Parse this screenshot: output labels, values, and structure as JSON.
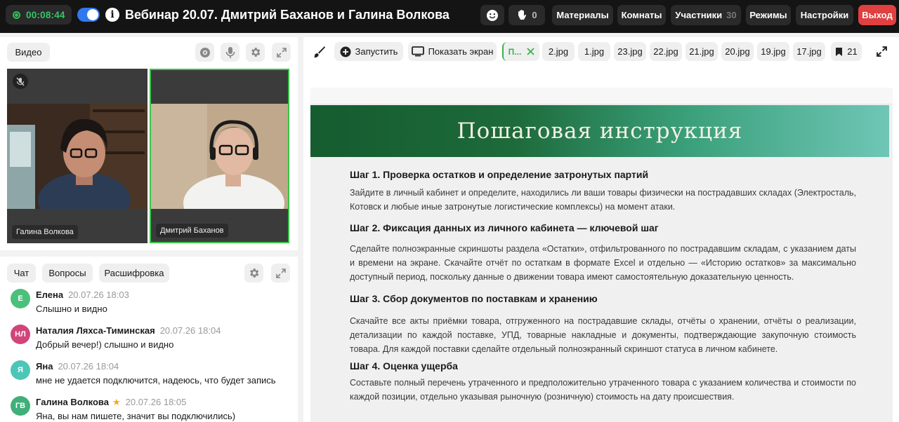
{
  "header": {
    "timer": "00:08:44",
    "title": "Вебинар 20.07. Дмитрий Баханов и Галина Волкова",
    "raised_hands": "0",
    "menu": {
      "materials": "Материалы",
      "rooms": "Комнаты",
      "participants": "Участники",
      "participants_count": "30",
      "modes": "Режимы",
      "settings": "Настройки",
      "exit": "Выход"
    }
  },
  "video": {
    "label": "Видео",
    "participants": [
      {
        "name": "Галина Волкова",
        "muted": true
      },
      {
        "name": "Дмитрий Баханов",
        "speaking": true
      }
    ]
  },
  "chat": {
    "tabs": [
      "Чат",
      "Вопросы",
      "Расшифровка"
    ],
    "messages": [
      {
        "initials": "Е",
        "author": "Елена",
        "time": "20.07.26 18:03",
        "text": "Слышно и видно",
        "color": "#4bc07b"
      },
      {
        "initials": "НЛ",
        "author": "Наталия Ляхса-Тиминская",
        "time": "20.07.26 18:04",
        "text": "Добрый вечер!) слышно и видно",
        "color": "#d0457a"
      },
      {
        "initials": "Я",
        "author": "Яна",
        "time": "20.07.26 18:04",
        "text": "мне не удается подключится, надеюсь, что будет запись",
        "color": "#4cc6b8"
      },
      {
        "initials": "ГВ",
        "author": "Галина Волкова",
        "time": "20.07.26 18:05",
        "text": "Яна, вы нам пишете, значит вы подключились)",
        "color": "#3fb07a",
        "star": "★"
      }
    ]
  },
  "content": {
    "toolbar": {
      "launch": "Запустить",
      "share_screen": "Показать экран",
      "active_file": "П...",
      "files": [
        "2.jpg",
        "1.jpg",
        "23.jpg",
        "22.jpg",
        "21.jpg",
        "20.jpg",
        "19.jpg",
        "17.jpg"
      ],
      "bookmark_count": "21"
    },
    "slide": {
      "title": "Пошаговая инструкция",
      "steps": [
        {
          "title": "Шаг 1. Проверка остатков и определение затронутых партий",
          "text": "Зайдите в личный кабинет и определите, находились ли ваши товары физически на пострадавших складах (Электросталь, Котовск и любые иные затронутые логистические комплексы) на момент атаки."
        },
        {
          "title": "Шаг 2. Фиксация данных из личного кабинета — ключевой шаг",
          "text": "Сделайте полноэкранные скриншоты раздела «Остатки», отфильтрованного по пострадавшим складам, с указанием даты и времени на экране. Скачайте отчёт по остаткам в формате Excel и отдельно — «Историю остатков» за максимально доступный период, поскольку данные о движении товара имеют самостоятельную доказательную ценность."
        },
        {
          "title": "Шаг 3. Сбор документов по поставкам и хранению",
          "text": "Скачайте все акты приёмки товара, отгруженного на пострадавшие склады, отчёты о хранении, отчёты о реализации, детализации по каждой поставке, УПД, товарные накладные и документы, подтверждающие закупочную стоимость товара. Для каждой поставки сделайте отдельный полноэкранный скриншот статуса в личном кабинете."
        },
        {
          "title": "Шаг 4. Оценка ущерба",
          "text": "Составьте полный перечень утраченного и предположительно утраченного товара с указанием количества и стоимости по каждой позиции, отдельно указывая рыночную (розничную) стоимость на дату происшествия."
        }
      ]
    }
  },
  "colors": {
    "accent_blue": "#2f78f0",
    "timer_green": "#35c466",
    "exit_red": "#e04040",
    "speaking_border": "#3bc24a",
    "star": "#f5a623"
  }
}
